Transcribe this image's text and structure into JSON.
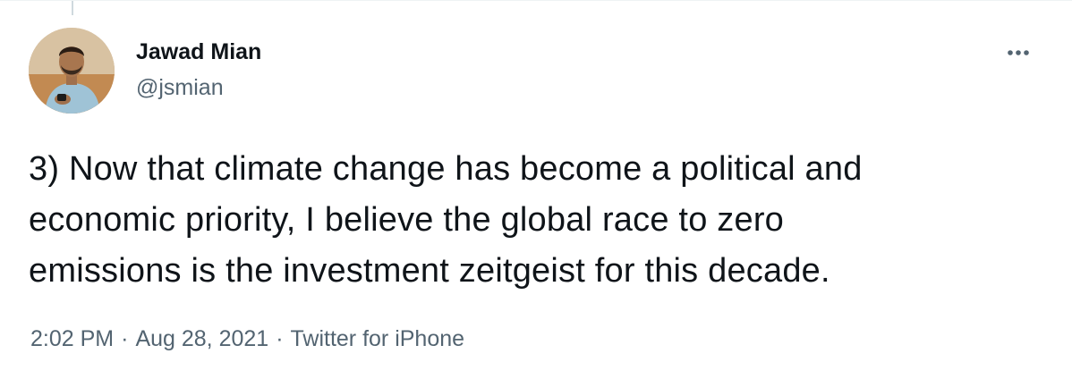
{
  "author": {
    "name": "Jawad Mian",
    "handle": "@jsmian"
  },
  "tweet": {
    "line1": "3) Now that climate change has become a political and",
    "line2": "economic priority, I believe the global race to zero",
    "line3": "emissions is the investment zeitgeist for this decade."
  },
  "meta": {
    "time": "2:02 PM",
    "separator": "·",
    "date": "Aug 28, 2021",
    "source": "Twitter for iPhone"
  },
  "icons": {
    "more": "more-horizontal-icon",
    "avatar": "profile-photo"
  },
  "colors": {
    "text": "#0f1419",
    "secondary": "#536471",
    "divider": "#eff3f4"
  }
}
